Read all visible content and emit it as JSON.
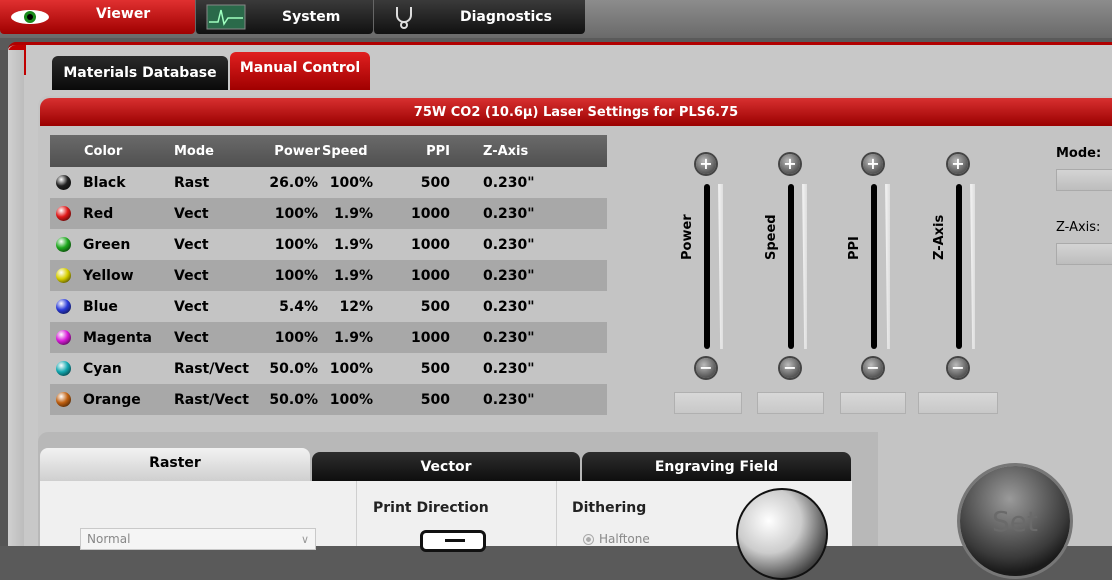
{
  "top_tabs": [
    {
      "label": "Viewer",
      "icon": "eye-icon",
      "active": true
    },
    {
      "label": "System",
      "icon": "waveform-icon",
      "active": false
    },
    {
      "label": "Diagnostics",
      "icon": "stethoscope-icon",
      "active": false
    }
  ],
  "sub_tabs": [
    {
      "label": "Materials Database",
      "active": false
    },
    {
      "label": "Manual Control",
      "active": true
    }
  ],
  "panel_title": "75W CO2 (10.6µ) Laser Settings for PLS6.75",
  "table": {
    "headers": {
      "color": "Color",
      "mode": "Mode",
      "power": "Power",
      "speed": "Speed",
      "ppi": "PPI",
      "z": "Z-Axis"
    },
    "rows": [
      {
        "color": "Black",
        "swatch": "#202020",
        "mode": "Rast",
        "power": "26.0%",
        "speed": "100%",
        "ppi": "500",
        "z": "0.230\""
      },
      {
        "color": "Red",
        "swatch": "#e01818",
        "mode": "Vect",
        "power": "100%",
        "speed": "1.9%",
        "ppi": "1000",
        "z": "0.230\""
      },
      {
        "color": "Green",
        "swatch": "#1ea81e",
        "mode": "Vect",
        "power": "100%",
        "speed": "1.9%",
        "ppi": "1000",
        "z": "0.230\""
      },
      {
        "color": "Yellow",
        "swatch": "#d8d000",
        "mode": "Vect",
        "power": "100%",
        "speed": "1.9%",
        "ppi": "1000",
        "z": "0.230\""
      },
      {
        "color": "Blue",
        "swatch": "#2a3ad8",
        "mode": "Vect",
        "power": "5.4%",
        "speed": "12%",
        "ppi": "500",
        "z": "0.230\""
      },
      {
        "color": "Magenta",
        "swatch": "#d81ad8",
        "mode": "Vect",
        "power": "100%",
        "speed": "1.9%",
        "ppi": "1000",
        "z": "0.230\""
      },
      {
        "color": "Cyan",
        "swatch": "#12a8b0",
        "mode": "Rast/Vect",
        "power": "50.0%",
        "speed": "100%",
        "ppi": "500",
        "z": "0.230\""
      },
      {
        "color": "Orange",
        "swatch": "#c06010",
        "mode": "Rast/Vect",
        "power": "50.0%",
        "speed": "100%",
        "ppi": "500",
        "z": "0.230\""
      }
    ]
  },
  "sliders": [
    {
      "label": "Power"
    },
    {
      "label": "Speed"
    },
    {
      "label": "PPI"
    },
    {
      "label": "Z-Axis"
    }
  ],
  "side": {
    "mode_label": "Mode:",
    "z_label": "Z-Axis:"
  },
  "bottom_tabs": [
    {
      "label": "Raster",
      "active": true
    },
    {
      "label": "Vector",
      "active": false
    },
    {
      "label": "Engraving Field",
      "active": false
    }
  ],
  "raster": {
    "quality_value": "Normal",
    "print_direction_label": "Print Direction",
    "dithering_label": "Dithering",
    "dithering_option": "Halftone"
  },
  "set_button": "Set",
  "colors": {
    "accent_red": "#c00000",
    "dark_tab": "#111111"
  }
}
